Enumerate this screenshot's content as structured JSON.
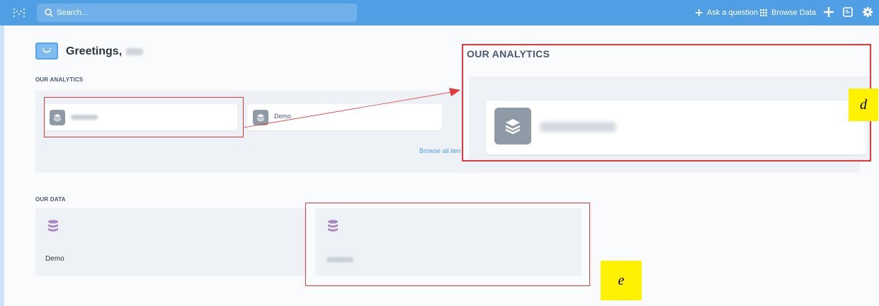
{
  "header": {
    "search_placeholder": "Search...",
    "ask_question": "Ask a question",
    "browse_data": "Browse Data",
    "accent_color": "#509ee3",
    "icons": [
      "logo-icon",
      "search-icon",
      "plus-icon",
      "grid-icon",
      "add-icon",
      "clipboard-icon",
      "gear-icon"
    ]
  },
  "greeting": {
    "text": "Greetings,"
  },
  "analytics": {
    "section_label": "OUR ANALYTICS",
    "cards": [
      {
        "title": ""
      },
      {
        "title": "Demo"
      }
    ],
    "browse_link": "Browse all iten"
  },
  "data": {
    "section_label": "OUR DATA",
    "cards": [
      {
        "title": "Demo"
      },
      {
        "title": ""
      }
    ]
  },
  "annotations": {
    "zoom_title": "OUR ANALYTICS",
    "label_d": "d",
    "label_e": "e",
    "annotation_color": "#e4383d",
    "label_bg": "#fff200"
  }
}
